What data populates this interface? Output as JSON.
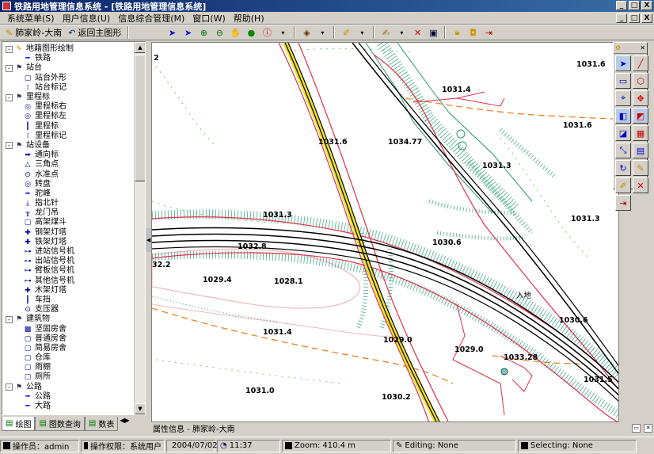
{
  "window": {
    "title": "铁路用地管理信息系统 - [铁路用地管理信息系统]",
    "min": "_",
    "max": "□",
    "close": "X"
  },
  "menubar": {
    "items": [
      "系统菜单(S)",
      "用户信息(U)",
      "信息综合管理(M)",
      "窗口(W)",
      "帮助(H)"
    ],
    "child_min": "_",
    "child_max": "□",
    "child_close": "X"
  },
  "toolbar": {
    "location": "肺家岭-大南",
    "back": "返回主图形"
  },
  "tree": [
    {
      "label": "地籍图形绘制",
      "level": 0,
      "exp": "-",
      "icon": "pencil"
    },
    {
      "label": "铁路",
      "level": 1,
      "icon": "line"
    },
    {
      "label": "站台",
      "level": 0,
      "exp": "-",
      "icon": "group"
    },
    {
      "label": "站台外形",
      "level": 1,
      "icon": "sq"
    },
    {
      "label": "站台标记",
      "level": 1,
      "icon": "mark"
    },
    {
      "label": "里程标",
      "level": 0,
      "exp": "-",
      "icon": "group"
    },
    {
      "label": "里程标右",
      "level": 1,
      "icon": "circ"
    },
    {
      "label": "里程标左",
      "level": 1,
      "icon": "circ"
    },
    {
      "label": "里程标",
      "level": 1,
      "icon": "bar"
    },
    {
      "label": "里程标记",
      "level": 1,
      "icon": "mark"
    },
    {
      "label": "站设备",
      "level": 0,
      "exp": "-",
      "icon": "group"
    },
    {
      "label": "通向标",
      "level": 1,
      "icon": "arrow"
    },
    {
      "label": "三角点",
      "level": 1,
      "icon": "tri"
    },
    {
      "label": "水准点",
      "level": 1,
      "icon": "dot"
    },
    {
      "label": "转盘",
      "level": 1,
      "icon": "circ"
    },
    {
      "label": "驼峰",
      "level": 1,
      "icon": "line"
    },
    {
      "label": "指北针",
      "level": 1,
      "icon": "north"
    },
    {
      "label": "龙门吊",
      "level": 1,
      "icon": "crane"
    },
    {
      "label": "高架煤斗",
      "level": 1,
      "icon": "sq"
    },
    {
      "label": "钢架灯塔",
      "level": 1,
      "icon": "light"
    },
    {
      "label": "铁架灯塔",
      "level": 1,
      "icon": "light"
    },
    {
      "label": "进站信号机",
      "level": 1,
      "icon": "sig"
    },
    {
      "label": "出站信号机",
      "level": 1,
      "icon": "sig"
    },
    {
      "label": "臂板信号机",
      "level": 1,
      "icon": "sig"
    },
    {
      "label": "其他信号机",
      "level": 1,
      "icon": "sig"
    },
    {
      "label": "木架灯塔",
      "level": 1,
      "icon": "light"
    },
    {
      "label": "车挡",
      "level": 1,
      "icon": "bar"
    },
    {
      "label": "支压器",
      "level": 1,
      "icon": "dot"
    },
    {
      "label": "建筑物",
      "level": 0,
      "exp": "-",
      "icon": "group"
    },
    {
      "label": "坚固房舍",
      "level": 1,
      "icon": "hatch"
    },
    {
      "label": "普通房舍",
      "level": 1,
      "icon": "sq"
    },
    {
      "label": "简易房舍",
      "level": 1,
      "icon": "sq"
    },
    {
      "label": "仓库",
      "level": 1,
      "icon": "sq"
    },
    {
      "label": "雨棚",
      "level": 1,
      "icon": "sq"
    },
    {
      "label": "厕所",
      "level": 1,
      "icon": "sq"
    },
    {
      "label": "公路",
      "level": 0,
      "exp": "-",
      "icon": "group"
    },
    {
      "label": "公路",
      "level": 1,
      "icon": "line"
    },
    {
      "label": "大路",
      "level": 1,
      "icon": "line"
    }
  ],
  "left_tabs": [
    {
      "label": "绘图",
      "active": true
    },
    {
      "label": "图数查询",
      "active": false
    },
    {
      "label": "数表",
      "active": false
    }
  ],
  "prop_bar": {
    "title": "属性信息 - 肺家岭-大南"
  },
  "statusbar": {
    "operator": "操作员：admin",
    "perm": "操作权限：系统用户",
    "date": "2004/07/02",
    "time": "11:37",
    "zoom": "Zoom: 410.4 m",
    "editing": "Editing: None",
    "selecting": "Selecting: None"
  },
  "map": {
    "labels": [
      {
        "t": "1031.6",
        "k": "a"
      },
      {
        "t": "1031.4",
        "k": "b"
      },
      {
        "t": "1031.6",
        "k": "c"
      },
      {
        "t": "1031.6",
        "k": "d"
      },
      {
        "t": "1034.77",
        "k": "e"
      },
      {
        "t": "1031.3",
        "k": "f"
      },
      {
        "t": "1031.3",
        "k": "g"
      },
      {
        "t": "1031.3",
        "k": "h"
      },
      {
        "t": "1032.8",
        "k": "i"
      },
      {
        "t": "1030.6",
        "k": "j"
      },
      {
        "t": "32.2",
        "k": "k"
      },
      {
        "t": "1029.4",
        "k": "l"
      },
      {
        "t": "1028.1",
        "k": "m"
      },
      {
        "t": "1031.4",
        "k": "n"
      },
      {
        "t": "1029.0",
        "k": "o"
      },
      {
        "t": "1029.0",
        "k": "p"
      },
      {
        "t": "1033.28",
        "k": "q"
      },
      {
        "t": "1030.6",
        "k": "r"
      },
      {
        "t": "1031.0",
        "k": "s"
      },
      {
        "t": "1030.2",
        "k": "t"
      },
      {
        "t": "1031.5",
        "k": "u"
      },
      {
        "t": "2",
        "k": "v"
      },
      {
        "t": "入地",
        "k": "w"
      }
    ],
    "colors": {
      "boundary": "#e0304a",
      "rail": "#000000",
      "rail_hl": "#f0e020",
      "embank": "#2a9a78",
      "contour": "#f08020",
      "veg": "#6ad060",
      "land": "#f0b8b8"
    }
  }
}
